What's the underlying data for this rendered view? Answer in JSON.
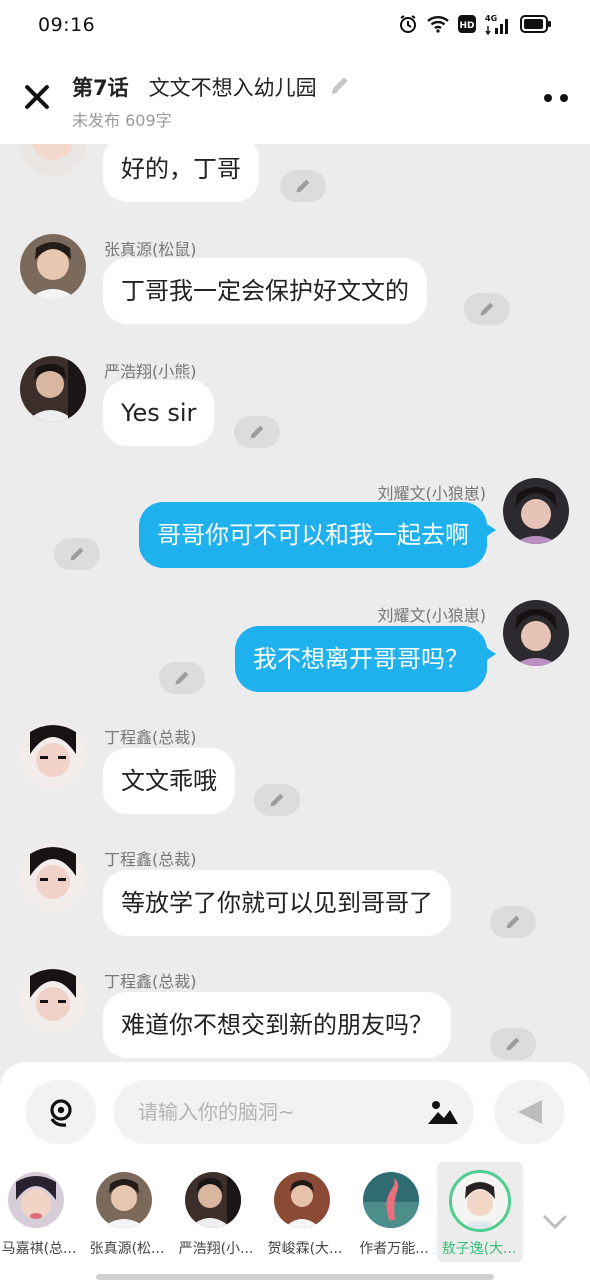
{
  "status_bar": {
    "time": "09:16",
    "network": "4G",
    "icons": [
      "alarm-icon",
      "wifi-icon",
      "hd-icon",
      "signal-icon",
      "battery-icon"
    ]
  },
  "header": {
    "episode": "第7话",
    "title": "文文不想入幼儿园",
    "subtitle": "未发布 609字",
    "icons": [
      "close-icon",
      "edit-pencil-icon",
      "more-icon"
    ]
  },
  "messages": [
    {
      "side": "left",
      "speaker": "",
      "text": "好的，丁哥"
    },
    {
      "side": "left",
      "speaker": "张真源(松鼠)",
      "text": "丁哥我一定会保护好文文的"
    },
    {
      "side": "left",
      "speaker": "严浩翔(小熊)",
      "text": "Yes  sir"
    },
    {
      "side": "right",
      "speaker": "刘耀文(小狼崽)",
      "text": "哥哥你可不可以和我一起去啊"
    },
    {
      "side": "right",
      "speaker": "刘耀文(小狼崽)",
      "text": "我不想离开哥哥吗？"
    },
    {
      "side": "left",
      "speaker": "丁程鑫(总裁)",
      "text": "文文乖哦"
    },
    {
      "side": "left",
      "speaker": "丁程鑫(总裁)",
      "text": "等放学了你就可以见到哥哥了"
    },
    {
      "side": "left",
      "speaker": "丁程鑫(总裁)",
      "text": "难道你不想交到新的朋友吗？"
    }
  ],
  "input": {
    "placeholder": "请输入你的脑洞~",
    "value": ""
  },
  "characters": [
    {
      "label": "马嘉祺(总..."
    },
    {
      "label": "张真源(松..."
    },
    {
      "label": "严浩翔(小..."
    },
    {
      "label": "贺峻霖(大..."
    },
    {
      "label": "作者万能..."
    },
    {
      "label": "敖子逸(大..."
    }
  ],
  "colors": {
    "accent_blue": "#1fb0ee",
    "accent_green": "#35c07a",
    "chat_background": "#ececec"
  }
}
